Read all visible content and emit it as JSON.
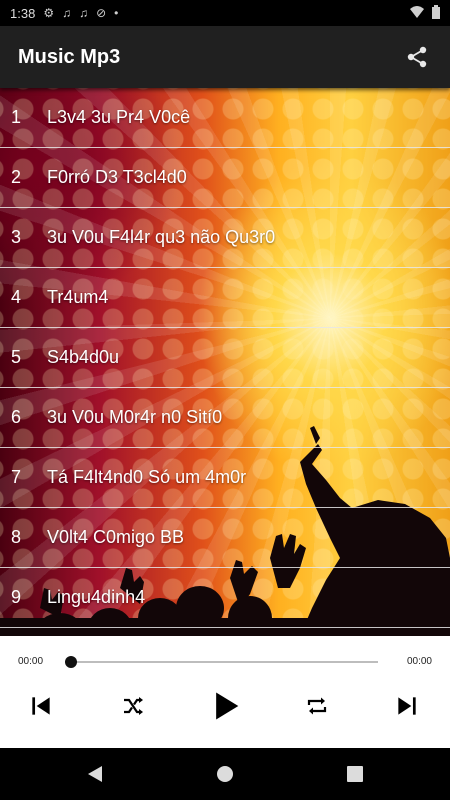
{
  "status_bar": {
    "time": "1:38",
    "icons": [
      "gear-icon",
      "music-note-icon",
      "music-note-icon",
      "no-sim-icon",
      "dot-icon",
      "wifi-icon",
      "battery-icon"
    ]
  },
  "app_bar": {
    "title": "Music Mp3",
    "share_icon": "share-icon"
  },
  "songs": [
    {
      "num": "1",
      "name": "L3v4 3u Pr4 V0cê"
    },
    {
      "num": "2",
      "name": "F0rró D3 T3cl4d0"
    },
    {
      "num": "3",
      "name": "3u V0u F4l4r qu3 não Qu3r0"
    },
    {
      "num": "4",
      "name": "Tr4um4"
    },
    {
      "num": "5",
      "name": "S4b4d0u"
    },
    {
      "num": "6",
      "name": "3u V0u M0r4r n0 Sití0"
    },
    {
      "num": "7",
      "name": "Tá F4lt4nd0 Só um 4m0r"
    },
    {
      "num": "8",
      "name": "V0lt4 C0migo BB"
    },
    {
      "num": "9",
      "name": "Lingu4dinh4"
    }
  ],
  "player": {
    "current_time": "00:00",
    "total_time": "00:00",
    "progress": 0,
    "controls": [
      "skip-previous-icon",
      "shuffle-icon",
      "play-icon",
      "repeat-icon",
      "skip-next-icon"
    ]
  },
  "nav_bar": {
    "buttons": [
      "back-icon",
      "home-icon",
      "recents-icon"
    ]
  }
}
